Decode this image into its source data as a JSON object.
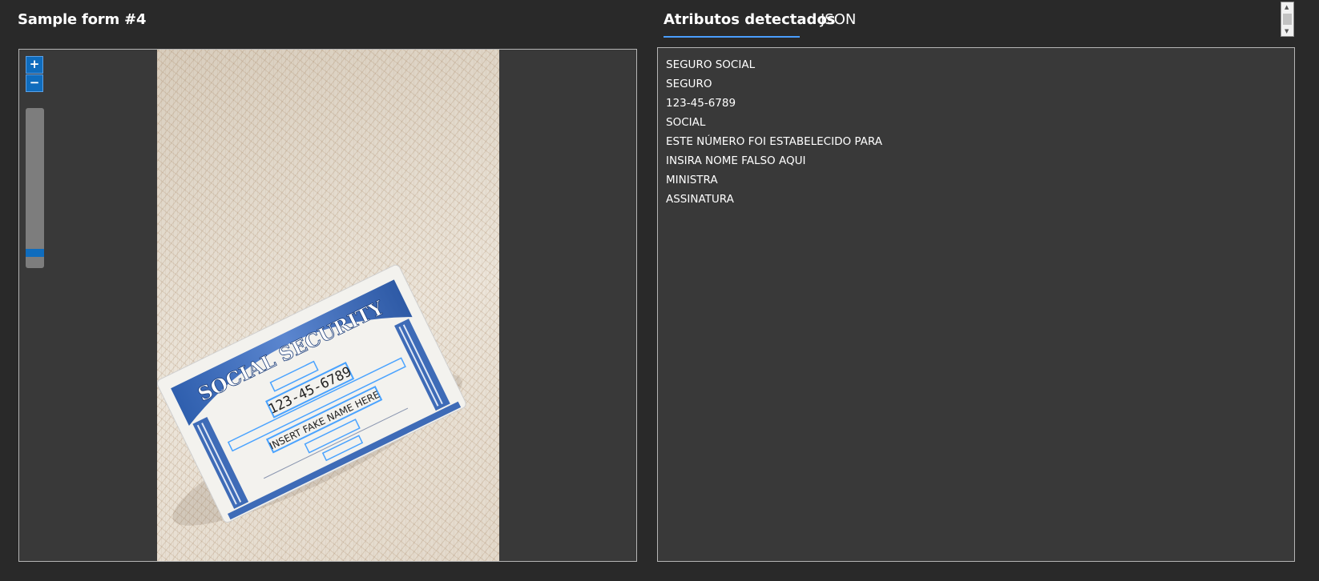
{
  "header": {
    "title": "Sample form #4"
  },
  "viewer": {
    "zoom_in_label": "+",
    "zoom_out_label": "−",
    "zoom_level": 0.1,
    "card_text": {
      "heading": "SOCIAL SECURITY",
      "number": "123-45-6789",
      "name_line": "INSERT FAKE NAME HERE"
    }
  },
  "tabs": [
    {
      "label": "Atributos detectados",
      "active": true
    },
    {
      "label": "JSON",
      "active": false
    }
  ],
  "attributes": [
    " SEGURO  SOCIAL",
    "SEGURO",
    "123-45-6789",
    "SOCIAL",
    "ESTE  NÚMERO  FOI  ESTABELECIDO  PARA",
    "INSIRA  NOME  FALSO  AQUI",
    "MINISTRA",
    "ASSINATURA"
  ],
  "colors": {
    "accent": "#0f6cbd",
    "tab_underline": "#4a9eff",
    "background": "#292929",
    "panel": "#393939"
  }
}
